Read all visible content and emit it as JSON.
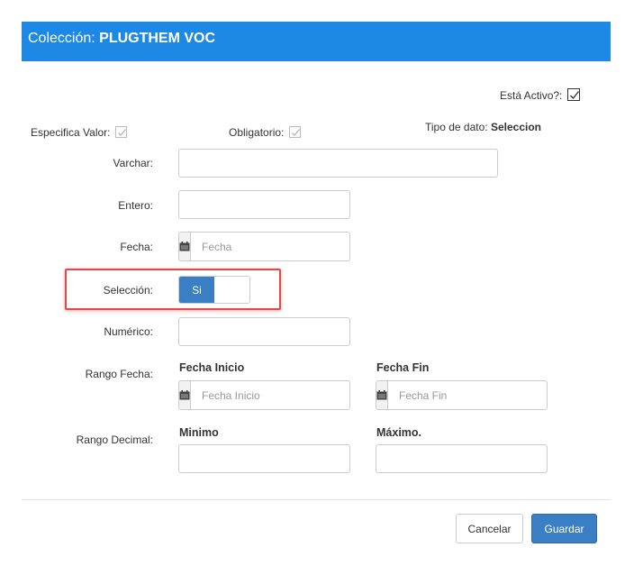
{
  "header": {
    "prefix": "Colección:",
    "name": "PLUGTHEM VOC"
  },
  "activo": {
    "label": "Está Activo?:",
    "checked": true
  },
  "especifica_valor": {
    "label": "Especifica Valor:",
    "checked": true
  },
  "obligatorio": {
    "label": "Obligatorio:",
    "checked": true
  },
  "tipo_dato": {
    "label": "Tipo de dato:",
    "value": "Seleccion"
  },
  "fields": {
    "varchar": {
      "label": "Varchar:",
      "value": ""
    },
    "entero": {
      "label": "Entero:",
      "value": ""
    },
    "fecha": {
      "label": "Fecha:",
      "placeholder": "Fecha"
    },
    "seleccion": {
      "label": "Selección:",
      "toggle_label": "Si",
      "on": true
    },
    "numerico": {
      "label": "Numérico:",
      "value": ""
    },
    "rango_fecha": {
      "label": "Rango Fecha:",
      "inicio_heading": "Fecha Inicio",
      "inicio_placeholder": "Fecha Inicio",
      "fin_heading": "Fecha Fin",
      "fin_placeholder": "Fecha Fin"
    },
    "rango_decimal": {
      "label": "Rango Decimal:",
      "minimo_heading": "Minimo",
      "maximo_heading": "Máximo."
    }
  },
  "buttons": {
    "cancel": "Cancelar",
    "save": "Guardar"
  },
  "icons": {
    "checkbox": "checkmark-icon",
    "date": "calendar-icon"
  },
  "colors": {
    "header": "#1e88e5",
    "primary": "#3a7fc4",
    "highlight": "#e8474a"
  }
}
